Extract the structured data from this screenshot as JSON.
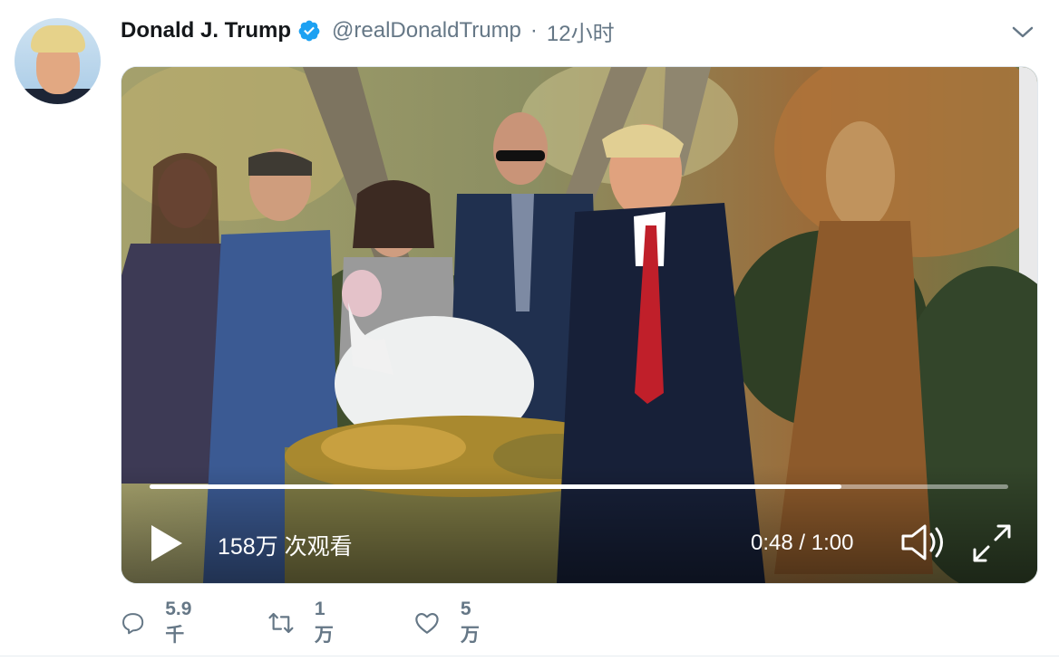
{
  "tweet": {
    "display_name": "Donald J. Trump",
    "handle": "@realDonaldTrump",
    "separator": "·",
    "timestamp": "12小时",
    "verified": true,
    "avatar_icon": "user-avatar",
    "menu_icon": "chevron-down-icon"
  },
  "video": {
    "view_count": "158万 次观看",
    "timecode": "0:48 / 1:00",
    "progress": 0.806,
    "play_icon": "play-icon",
    "volume_icon": "volume-icon",
    "fullscreen_icon": "fullscreen-expand-icon"
  },
  "actions": {
    "reply": {
      "icon": "reply-icon",
      "count": "5.9千"
    },
    "retweet": {
      "icon": "retweet-icon",
      "count": "1万"
    },
    "like": {
      "icon": "heart-icon",
      "count": "5万"
    }
  },
  "colors": {
    "verified_blue": "#1da1f2",
    "secondary_text": "#657786",
    "primary_text": "#14171a"
  }
}
